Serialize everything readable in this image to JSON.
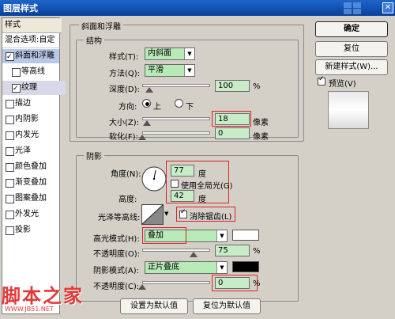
{
  "window": {
    "title": "图层样式"
  },
  "left_panel": {
    "header": "样式",
    "blend_options": "混合选项:自定",
    "items": [
      {
        "label": "斜面和浮雕",
        "checked": true
      },
      {
        "label": "等高线",
        "checked": false
      },
      {
        "label": "纹理",
        "checked": true
      },
      {
        "label": "描边",
        "checked": false
      },
      {
        "label": "内阴影",
        "checked": false
      },
      {
        "label": "内发光",
        "checked": false
      },
      {
        "label": "光泽",
        "checked": false
      },
      {
        "label": "颜色叠加",
        "checked": false
      },
      {
        "label": "渐变叠加",
        "checked": false
      },
      {
        "label": "图案叠加",
        "checked": false
      },
      {
        "label": "外发光",
        "checked": false
      },
      {
        "label": "投影",
        "checked": false
      }
    ]
  },
  "bevel": {
    "title": "斜面和浮雕",
    "structure_title": "结构",
    "style_label": "样式(T):",
    "style_value": "内斜面",
    "technique_label": "方法(Q):",
    "technique_value": "平滑",
    "depth_label": "深度(D):",
    "depth_value": "100",
    "depth_unit": "%",
    "depth_fraction": 0.1,
    "direction_label": "方向:",
    "direction_up": "上",
    "direction_down": "下",
    "size_label": "大小(Z):",
    "size_value": "18",
    "size_unit": "像素",
    "size_fraction": 0.07,
    "soften_label": "软化(F):",
    "soften_value": "0",
    "soften_unit": "像素",
    "soften_fraction": 0.0
  },
  "shading": {
    "title": "阴影",
    "angle_label": "角度(N):",
    "angle_value": "77",
    "angle_unit": "度",
    "global_light_label": "使用全局光(G)",
    "altitude_label": "高度:",
    "altitude_value": "42",
    "altitude_unit": "度",
    "gloss_label": "光泽等高线:",
    "antialias_label": "消除锯齿(L)",
    "highlight_mode_label": "高光模式(H):",
    "highlight_mode_value": "叠加",
    "highlight_opacity_label": "不透明度(O):",
    "highlight_opacity_value": "75",
    "highlight_opacity_fraction": 0.75,
    "shadow_mode_label": "阴影模式(A):",
    "shadow_mode_value": "正片叠底",
    "shadow_opacity_label": "不透明度(C):",
    "shadow_opacity_value": "0",
    "shadow_opacity_fraction": 0.0,
    "percent": "%"
  },
  "buttons": {
    "ok": "确定",
    "reset": "复位",
    "new_style": "新建样式(W)...",
    "preview": "预览(V)",
    "make_default": "设置为默认值",
    "reset_default": "复位为默认值"
  },
  "watermark": {
    "text": "脚本之家",
    "url": "WWW.JB51.NET"
  },
  "colors": {
    "highlight": "#ffffff",
    "shadow": "#000000",
    "field": "#c8ecc8",
    "title_bar": "#1c66c9",
    "annotation": "#d22222"
  }
}
